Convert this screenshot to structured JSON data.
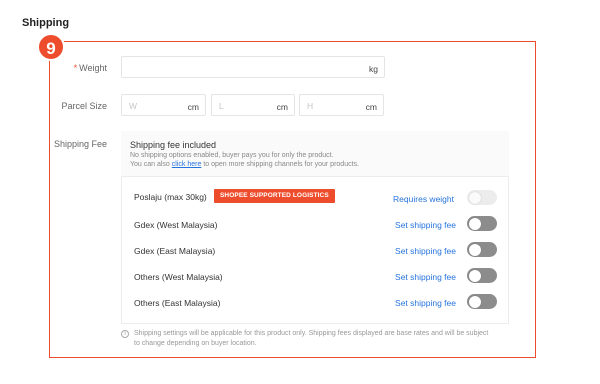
{
  "section": {
    "title": "Shipping",
    "step_number": "9"
  },
  "weight": {
    "label": "Weight",
    "required_mark": "*",
    "unit": "kg",
    "value": ""
  },
  "parcel_size": {
    "label": "Parcel Size",
    "fields": [
      {
        "placeholder": "W",
        "unit": "cm"
      },
      {
        "placeholder": "L",
        "unit": "cm"
      },
      {
        "placeholder": "H",
        "unit": "cm"
      }
    ]
  },
  "shipping_fee": {
    "label": "Shipping Fee",
    "heading": "Shipping fee included",
    "note_line1": "No shipping options enabled, buyer pays you for only the product.",
    "note_line2_prefix": "You can also",
    "note_line2_link": "click here",
    "note_line2_suffix": "to open more shipping channels for your products.",
    "channels": [
      {
        "name": "Poslaju  (max 30kg)",
        "tag": "SHOPEE SUPPORTED LOGISTICS",
        "action": "Requires weight",
        "enabled": false,
        "disabled": true
      },
      {
        "name": "Gdex (West Malaysia)",
        "action": "Set shipping fee",
        "enabled": false
      },
      {
        "name": "Gdex (East Malaysia)",
        "action": "Set shipping fee",
        "enabled": false
      },
      {
        "name": "Others (West Malaysia)",
        "action": "Set shipping fee",
        "enabled": false
      },
      {
        "name": "Others (East Malaysia)",
        "action": "Set shipping fee",
        "enabled": false
      }
    ],
    "footnote_line1": "Shipping settings will be applicable for this product only. Shipping fees displayed are base rates and will be subject",
    "footnote_line2": "to change depending on buyer location."
  },
  "colors": {
    "accent": "#ee4d2d",
    "link": "#2673dd"
  }
}
